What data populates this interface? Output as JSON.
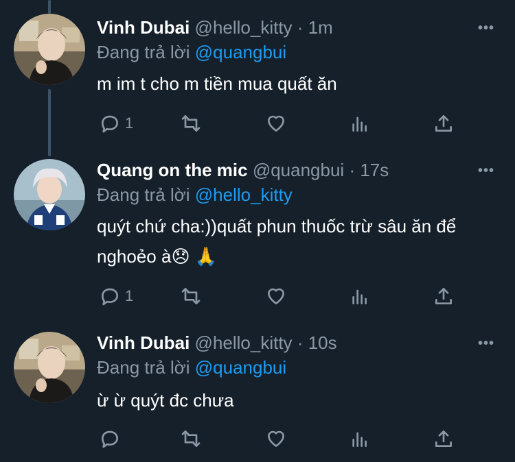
{
  "tweets": [
    {
      "name": "Vinh Dubai",
      "handle": "@hello_kitty",
      "dot": "·",
      "time": "1m",
      "replying_prefix": "Đang trả lời ",
      "replying_to": "@quangbui",
      "text": "m im t cho m tiền mua quất ăn",
      "reply_count": "1",
      "more": "•••"
    },
    {
      "name": "Quang on the mic",
      "handle": "@quangbui",
      "dot": "·",
      "time": "17s",
      "replying_prefix": "Đang trả lời ",
      "replying_to": "@hello_kitty",
      "text": "quýt chứ cha:))quất phun thuốc trừ sâu ăn để nghoẻo à😞 🙏",
      "reply_count": "1",
      "more": "•••"
    },
    {
      "name": "Vinh Dubai",
      "handle": "@hello_kitty",
      "dot": "·",
      "time": "10s",
      "replying_prefix": "Đang trả lời ",
      "replying_to": "@quangbui",
      "text": "ừ ừ quýt đc chưa",
      "reply_count": "",
      "more": "•••"
    }
  ],
  "icons": {
    "reply": "reply-icon",
    "retweet": "retweet-icon",
    "like": "heart-icon",
    "analytics": "analytics-icon",
    "share": "share-icon",
    "more": "more-icon"
  },
  "colors": {
    "background": "#15202b",
    "mention": "#1d9bf0",
    "muted": "#8b98a5",
    "thread_line": "#3d5466"
  }
}
